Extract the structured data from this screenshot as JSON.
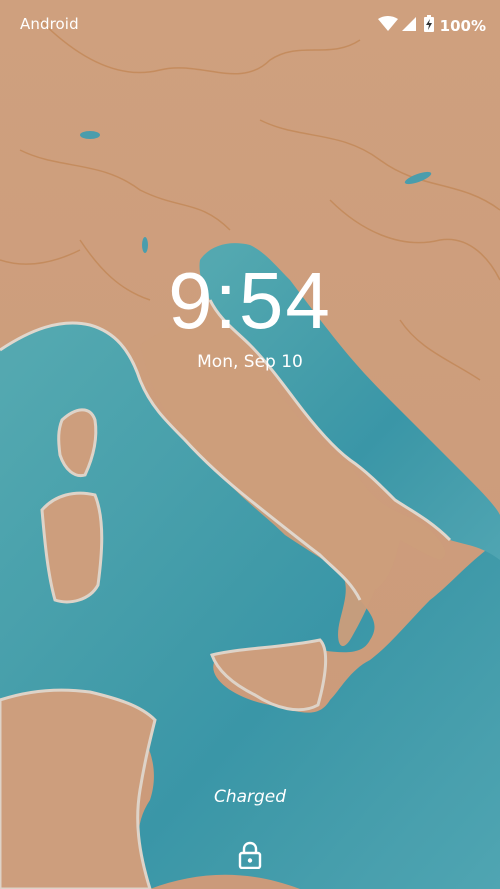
{
  "status_bar": {
    "carrier": "Android",
    "battery_percent": "100%",
    "icons": [
      "wifi-icon",
      "cellular-signal-icon",
      "battery-charging-icon"
    ]
  },
  "lockscreen": {
    "time": "9:54",
    "date": "Mon, Sep 10",
    "charging_status": "Charged",
    "lock_icon": "lock-icon"
  },
  "wallpaper": {
    "description_color_land": "#d9a884",
    "description_color_sea": "#4faab5"
  }
}
